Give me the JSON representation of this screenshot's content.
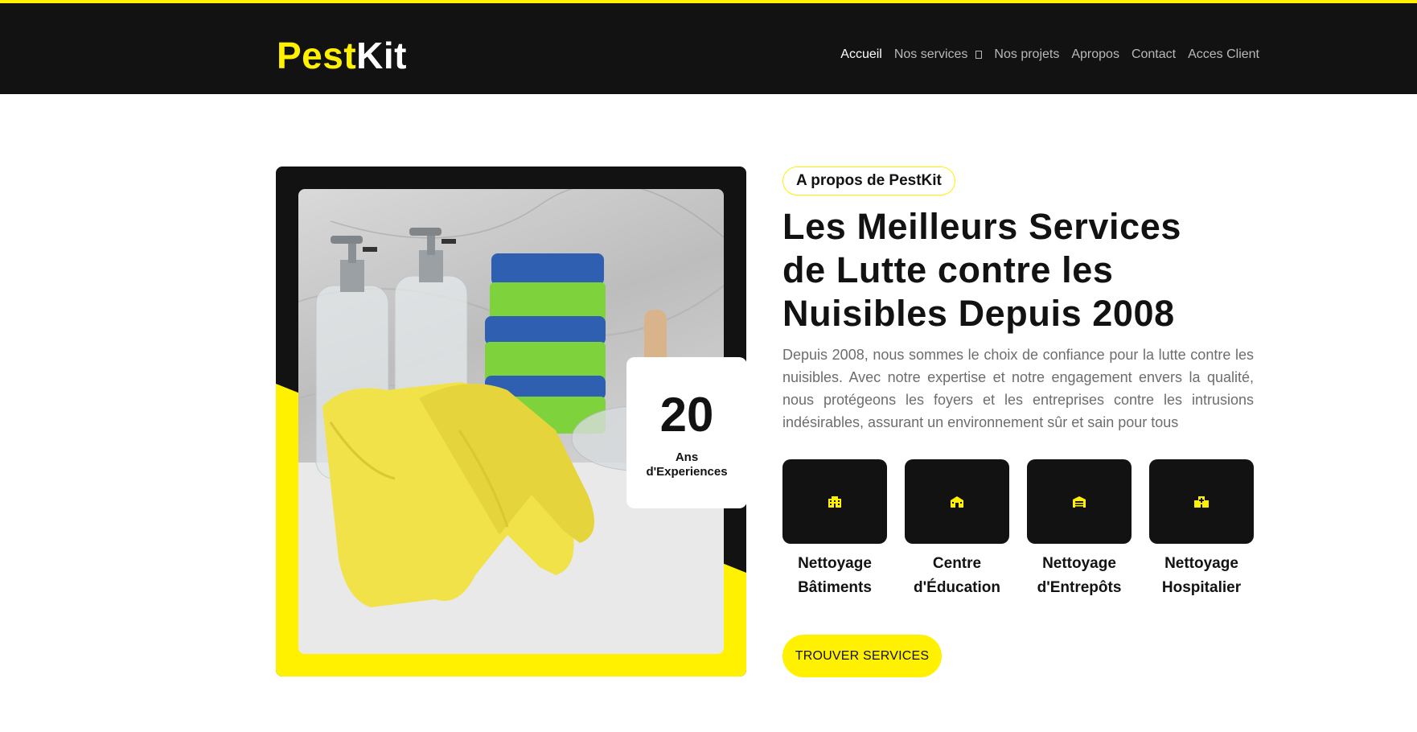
{
  "brand": {
    "part1": "Pest",
    "part2": "Kit",
    "accent_color": "#fff100",
    "dark_color": "#121212"
  },
  "nav": {
    "items": [
      {
        "label": "Accueil",
        "active": true
      },
      {
        "label": "Nos services",
        "dropdown": true
      },
      {
        "label": "Nos projets"
      },
      {
        "label": "Apropos"
      },
      {
        "label": "Contact"
      },
      {
        "label": "Acces Client"
      }
    ]
  },
  "experience": {
    "number": "20",
    "line1": "Ans",
    "line2": "d'Experiences"
  },
  "about": {
    "badge": "A propos de PestKit",
    "title_line1": "Les Meilleurs Services",
    "title_line2": "de Lutte contre les",
    "title_line3": "Nuisibles Depuis 2008",
    "description": "Depuis 2008, nous sommes le choix de confiance pour la lutte contre les nuisibles. Avec notre expertise et notre engagement envers la qualité, nous protégeons les foyers et les entreprises contre les intrusions indésirables, assurant un environnement sûr et sain pour tous"
  },
  "services": [
    {
      "line1": "Nettoyage",
      "line2": "Bâtiments",
      "icon": "building-icon"
    },
    {
      "line1": "Centre",
      "line2": "d'Éducation",
      "icon": "school-icon"
    },
    {
      "line1": "Nettoyage",
      "line2": "d'Entrepôts",
      "icon": "warehouse-icon"
    },
    {
      "line1": "Nettoyage",
      "line2": "Hospitalier",
      "icon": "hospital-icon"
    }
  ],
  "cta": {
    "label": "TROUVER SERVICES"
  }
}
